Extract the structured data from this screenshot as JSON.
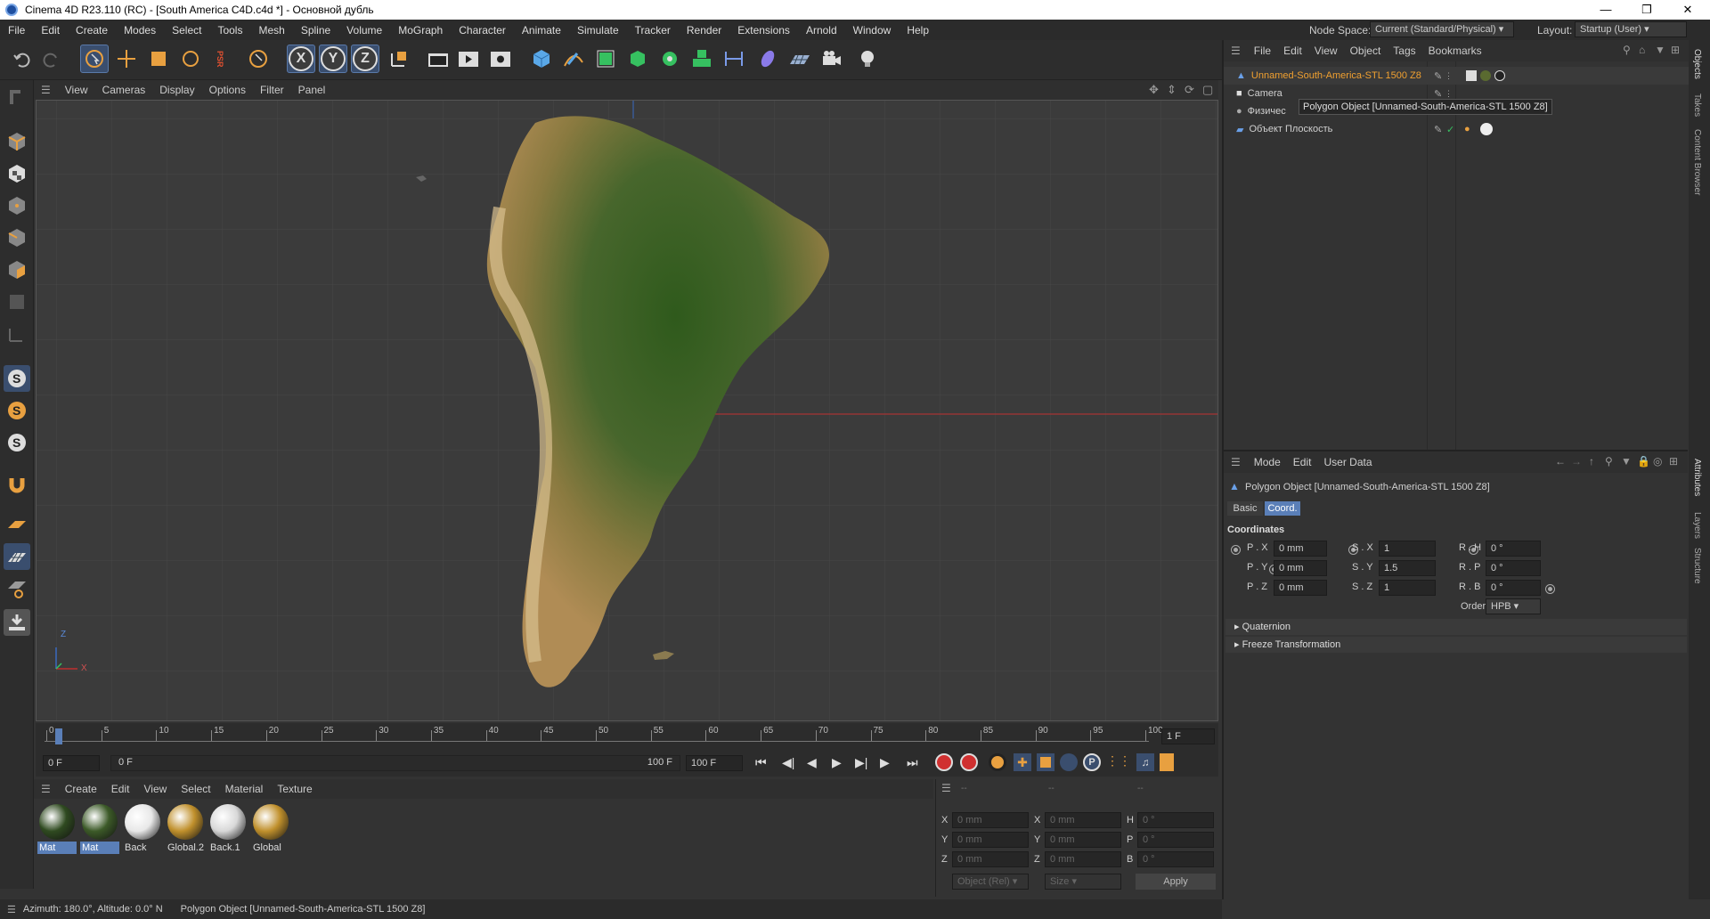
{
  "window": {
    "title": "Cinema 4D R23.110 (RC) - [South America C4D.c4d *] - Основной дубль"
  },
  "menubar": {
    "items": [
      "File",
      "Edit",
      "Create",
      "Modes",
      "Select",
      "Tools",
      "Mesh",
      "Spline",
      "Volume",
      "MoGraph",
      "Character",
      "Animate",
      "Simulate",
      "Tracker",
      "Render",
      "Extensions",
      "Arnold",
      "Window",
      "Help"
    ],
    "node_space_label": "Node Space:",
    "node_space_value": "Current (Standard/Physical)",
    "layout_label": "Layout:",
    "layout_value": "Startup (User)"
  },
  "toolbar": {
    "axis_x": "X",
    "axis_y": "Y",
    "axis_z": "Z",
    "psr": "PSR"
  },
  "viewport": {
    "menu": [
      "View",
      "Cameras",
      "Display",
      "Options",
      "Filter",
      "Panel"
    ],
    "axis_z": "Z",
    "axis_x": "X"
  },
  "timeline": {
    "ticks": [
      "0",
      "5",
      "10",
      "15",
      "20",
      "25",
      "30",
      "35",
      "40",
      "45",
      "50",
      "55",
      "60",
      "65",
      "70",
      "75",
      "80",
      "85",
      "90",
      "95",
      "100"
    ],
    "current_frame_field": "1 F"
  },
  "transport": {
    "start_frame": "0 F",
    "range_start": "0 F",
    "range_end": "100 F",
    "end_frame": "100 F"
  },
  "materials": {
    "menu": [
      "Create",
      "Edit",
      "View",
      "Select",
      "Material",
      "Texture"
    ],
    "items": [
      {
        "name": "Mat",
        "selected": true,
        "color": "#2f4a20"
      },
      {
        "name": "Mat",
        "selected": true,
        "color": "#3c5a28"
      },
      {
        "name": "Back",
        "selected": false,
        "color": "#e8e8e8"
      },
      {
        "name": "Global.2",
        "selected": false,
        "color": "#c0902c"
      },
      {
        "name": "Back.1",
        "selected": false,
        "color": "#d8d8d8"
      },
      {
        "name": "Global",
        "selected": false,
        "color": "#c0902c"
      }
    ]
  },
  "coord_manager": {
    "header": [
      "--",
      "--",
      "--"
    ],
    "col1": [
      "X",
      "Y",
      "Z"
    ],
    "col2": [
      "X",
      "Y",
      "Z"
    ],
    "col3": [
      "H",
      "P",
      "B"
    ],
    "val_mm": "0 mm",
    "val_deg": "0 °",
    "mode_select": "Object (Rel)",
    "size_select": "Size",
    "apply_label": "Apply"
  },
  "status": {
    "text": "Azimuth: 180.0°, Altitude: 0.0°  N",
    "object": "Polygon Object [Unnamed-South-America-STL 1500 Z8]"
  },
  "objects_panel": {
    "menu": [
      "File",
      "Edit",
      "View",
      "Object",
      "Tags",
      "Bookmarks"
    ],
    "rows": [
      {
        "name": "Unnamed-South-America-STL 1500 Z8",
        "active": true
      },
      {
        "name": "Camera",
        "active": false
      },
      {
        "name": "Физичес",
        "active": false
      },
      {
        "name": "Объект Плоскость",
        "active": false
      }
    ],
    "tooltip": "Polygon Object [Unnamed-South-America-STL 1500 Z8]"
  },
  "attributes_panel": {
    "menu": [
      "Mode",
      "Edit",
      "User Data"
    ],
    "object_title": "Polygon Object [Unnamed-South-America-STL 1500 Z8]",
    "tabs": [
      {
        "label": "Basic",
        "active": false
      },
      {
        "label": "Coord.",
        "active": true
      }
    ],
    "section": "Coordinates",
    "rows": [
      {
        "p_label": "P . X",
        "p_value": "0 mm",
        "s_label": "S . X",
        "s_value": "1",
        "r_label": "R . H",
        "r_value": "0 °"
      },
      {
        "p_label": "P . Y",
        "p_value": "0 mm",
        "s_label": "S . Y",
        "s_value": "1.5",
        "r_label": "R . P",
        "r_value": "0 °"
      },
      {
        "p_label": "P . Z",
        "p_value": "0 mm",
        "s_label": "S . Z",
        "s_value": "1",
        "r_label": "R . B",
        "r_value": "0 °"
      }
    ],
    "order_label": "Order",
    "order_value": "HPB",
    "folds": [
      "Quaternion",
      "Freeze Transformation"
    ]
  },
  "side_tabs": {
    "top": [
      "Objects",
      "Takes",
      "Content Browser"
    ],
    "bottom": [
      "Attributes",
      "Layers",
      "Structure"
    ]
  },
  "colors": {
    "accent": "#e8a040",
    "selection": "#5a7fb8",
    "active_object": "#f0a030"
  }
}
